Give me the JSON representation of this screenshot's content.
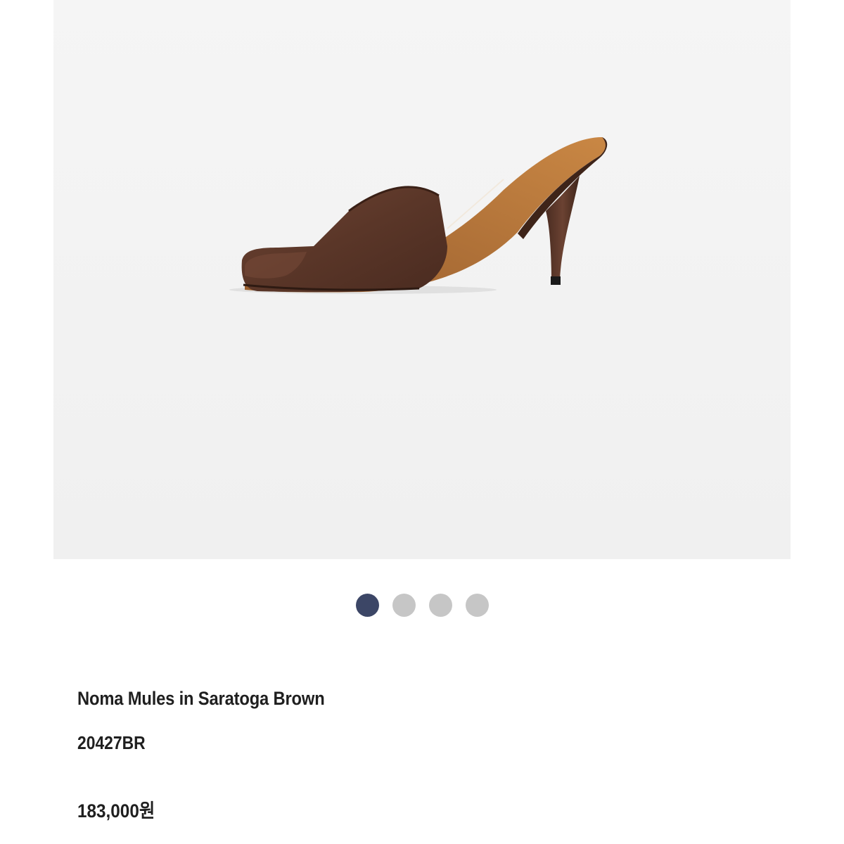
{
  "product": {
    "image_alt": "Brown leather square-toe heeled mule",
    "name": "Noma Mules in Saratoga Brown",
    "code": "20427BR",
    "price": "183,000원"
  },
  "carousel": {
    "slide_count": 4,
    "active_index": 0,
    "colors": {
      "active": "#3c4666",
      "inactive": "#c6c6c6"
    }
  },
  "colors": {
    "image_background": "#f3f3f3",
    "shoe_leather": "#5a3628",
    "shoe_insole": "#b87538",
    "text": "#1f1f1f"
  }
}
